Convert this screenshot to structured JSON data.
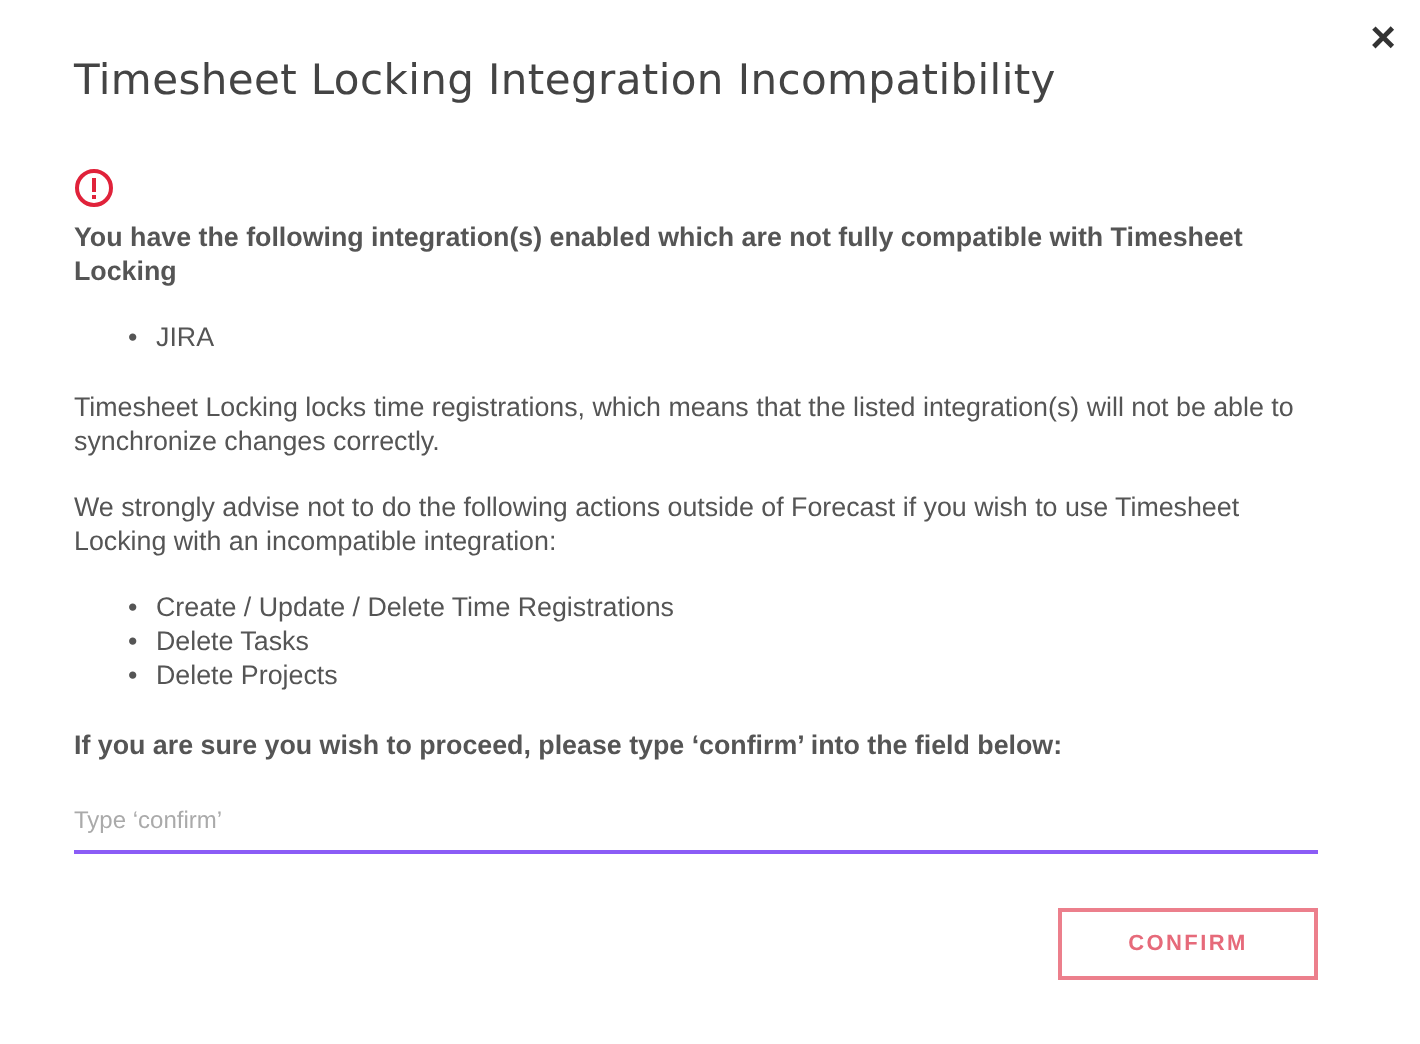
{
  "dialog": {
    "title": "Timesheet Locking Integration Incompatibility",
    "close": "×",
    "warning": "You have the following integration(s) enabled which are not fully compatible with Timesheet Locking",
    "integrations": [
      {
        "bullet": "•",
        "text": "JIRA"
      }
    ],
    "explanation": "Timesheet Locking locks time registrations, which means that the listed integration(s) will not be able to synchronize changes correctly.",
    "advice": "We strongly advise not to do the following actions outside of Forecast if you wish to use Timesheet Locking with an incompatible integration:",
    "actions": [
      {
        "bullet": "•",
        "text": "Create / Update / Delete Time Registrations"
      },
      {
        "bullet": "•",
        "text": "Delete Tasks"
      },
      {
        "bullet": "•",
        "text": "Delete Projects"
      }
    ],
    "prompt": "If you are sure you wish to proceed, please type ‘confirm’ into the field below:",
    "field": {
      "placeholder": "Type ‘confirm’"
    },
    "button": "CONFIRM"
  }
}
